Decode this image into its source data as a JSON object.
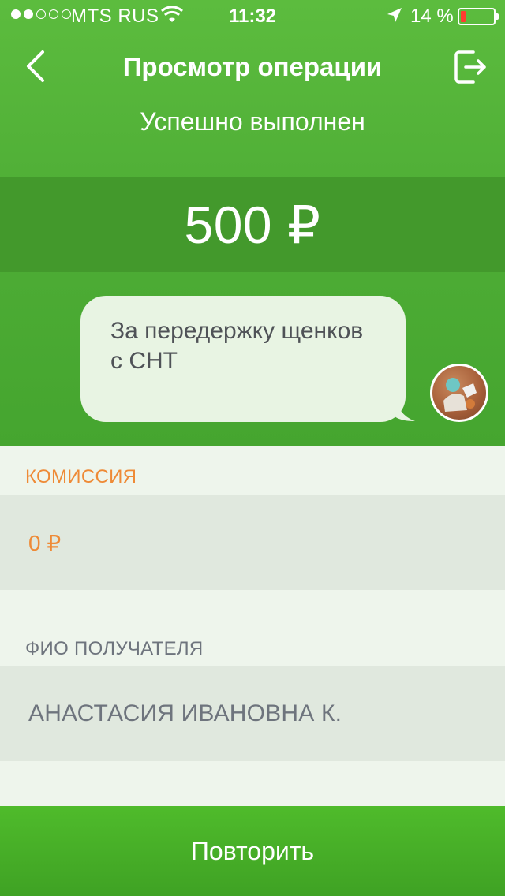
{
  "status_bar": {
    "carrier": "MTS RUS",
    "time": "11:32",
    "battery_percent": "14 %",
    "battery_level": 0.14,
    "signal_bars": 2
  },
  "nav": {
    "title": "Просмотр операции",
    "back_icon": "chevron-left-icon",
    "exit_icon": "logout-icon"
  },
  "operation": {
    "status": "Успешно выполнен",
    "amount": "500 ₽",
    "message": "За передержку щенков с СНТ"
  },
  "details": {
    "fee_label": "КОМИССИЯ",
    "fee_value": "0 ₽",
    "recipient_label": "ФИО ПОЛУЧАТЕЛЯ",
    "recipient_value": "АНАСТАСИЯ ИВАНОВНА К."
  },
  "actions": {
    "repeat_label": "Повторить"
  },
  "colors": {
    "brand_green": "#4fae36",
    "amount_band": "#43992c",
    "fee_accent": "#ee8a36",
    "battery_low": "#ff3b30"
  }
}
